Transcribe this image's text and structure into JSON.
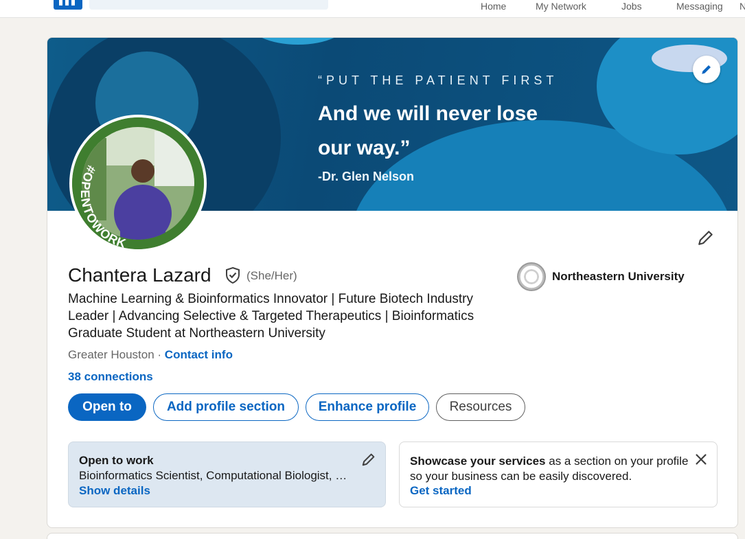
{
  "nav": {
    "items": [
      "Home",
      "My Network",
      "Jobs",
      "Messaging",
      "N"
    ]
  },
  "banner": {
    "quote_line1": "“PUT THE PATIENT FIRST",
    "quote_line2": "And we will never lose",
    "quote_line3": "our way.”",
    "attribution": "-Dr. Glen Nelson"
  },
  "avatar": {
    "frame_label": "#OPENTOWORK"
  },
  "profile": {
    "name": "Chantera Lazard",
    "pronouns": "(She/Her)",
    "headline": "Machine Learning & Bioinformatics Innovator | Future Biotech Industry Leader | Advancing Selective & Targeted Therapeutics | Bioinformatics Graduate Student at Northeastern University",
    "location": "Greater Houston",
    "location_separator": " · ",
    "contact_link": "Contact info",
    "connections": "38 connections",
    "school": "Northeastern University"
  },
  "actions": {
    "open_to": "Open to",
    "add_section": "Add profile section",
    "enhance": "Enhance profile",
    "resources": "Resources"
  },
  "open_to_work": {
    "title": "Open to work",
    "roles": "Bioinformatics Scientist, Computational Biologist, …",
    "link": "Show details"
  },
  "services": {
    "bold_text": "Showcase your services",
    "rest_text": " as a section on your profile so your business can be easily discovered.",
    "link": "Get started"
  },
  "colors": {
    "brand_blue": "#0a66c2",
    "otw_green": "#3f7e2f",
    "banner_blue": "#0b4a76"
  }
}
